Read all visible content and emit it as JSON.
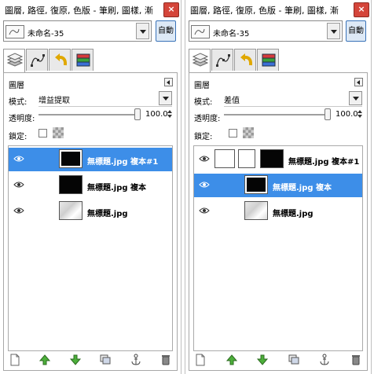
{
  "left": {
    "title": "圖層, 路徑, 復原, 色版 - 筆刷, 圖樣, 漸",
    "close_label": "×",
    "image_name": "未命名-35",
    "auto_label": "自動",
    "panel_title": "圖層",
    "mode_label": "模式:",
    "mode_value": "增益提取",
    "opacity_label": "透明度:",
    "opacity_value": "100.0",
    "opacity_fraction": 1.0,
    "lock_label": "鎖定:",
    "layers": [
      {
        "name": "無標題.jpg 複本#1",
        "selected": true,
        "thumb": "black",
        "mask": false
      },
      {
        "name": "無標題.jpg 複本",
        "selected": false,
        "thumb": "black",
        "mask": false
      },
      {
        "name": "無標題.jpg",
        "selected": false,
        "thumb": "photo",
        "mask": false
      }
    ]
  },
  "right": {
    "title": "圖層, 路徑, 復原, 色版 - 筆刷, 圖樣, 漸",
    "close_label": "×",
    "image_name": "未命名-35",
    "auto_label": "自動",
    "panel_title": "圖層",
    "mode_label": "模式:",
    "mode_value": "差值",
    "opacity_label": "透明度:",
    "opacity_value": "100.0",
    "opacity_fraction": 1.0,
    "lock_label": "鎖定:",
    "layers": [
      {
        "name": "無標題.jpg 複本#1",
        "selected": false,
        "thumb": "black",
        "mask": true
      },
      {
        "name": "無標題.jpg 複本",
        "selected": true,
        "thumb": "black",
        "mask": false
      },
      {
        "name": "無標題.jpg",
        "selected": false,
        "thumb": "photo",
        "mask": false
      }
    ]
  },
  "bottom_icons": [
    "new-layer-icon",
    "raise-layer-icon",
    "lower-layer-icon",
    "duplicate-layer-icon",
    "anchor-layer-icon",
    "delete-layer-icon"
  ],
  "colors": {
    "selection": "#3d8ee8",
    "close": "#d4453a",
    "auto_border": "#3a73b8"
  }
}
